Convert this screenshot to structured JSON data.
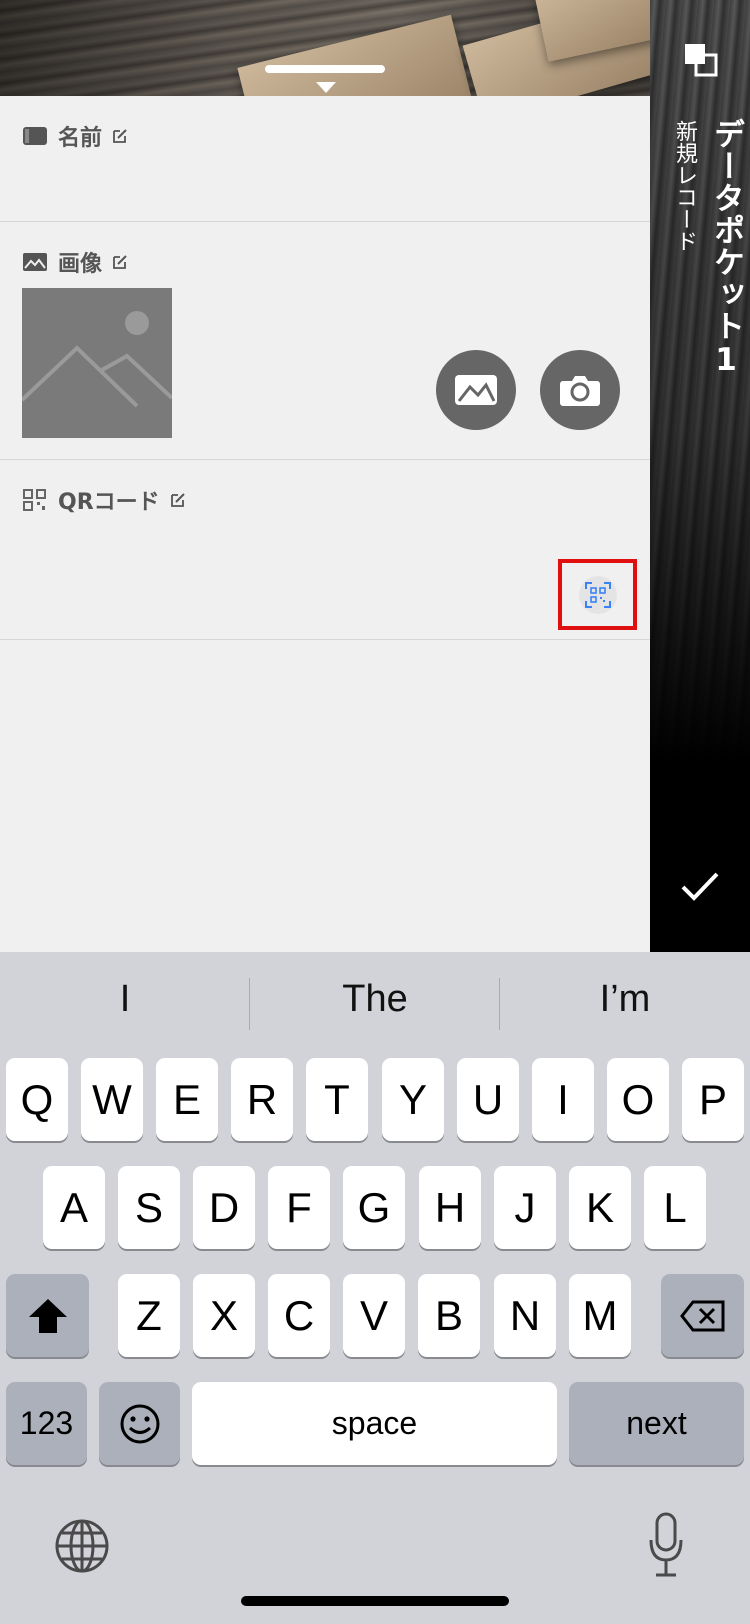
{
  "header": {
    "title": "データポケット1",
    "subtitle": "新規レコード"
  },
  "fields": [
    {
      "label": "名前",
      "icon": "name-card-icon"
    },
    {
      "label": "画像",
      "icon": "image-icon"
    },
    {
      "label": "QRコード",
      "icon": "qr-code-icon"
    }
  ],
  "keyboard": {
    "suggestions": [
      "I",
      "The",
      "I’m"
    ],
    "row1": [
      "Q",
      "W",
      "E",
      "R",
      "T",
      "Y",
      "U",
      "I",
      "O",
      "P"
    ],
    "row2": [
      "A",
      "S",
      "D",
      "F",
      "G",
      "H",
      "J",
      "K",
      "L"
    ],
    "row3": [
      "Z",
      "X",
      "C",
      "V",
      "B",
      "N",
      "M"
    ],
    "numbers_label": "123",
    "space_label": "space",
    "return_label": "next"
  },
  "colors": {
    "highlight": "#e01010",
    "qr_scan_icon": "#3b82f6",
    "button_gray": "#666666"
  }
}
